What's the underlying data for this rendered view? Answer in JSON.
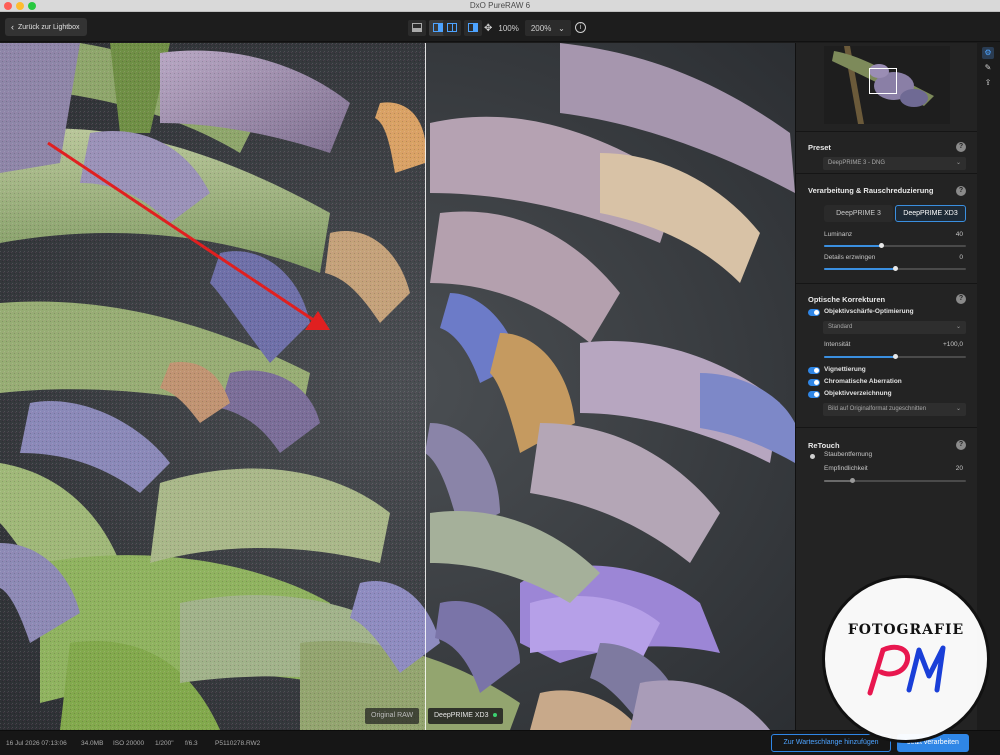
{
  "window": {
    "title": "DxO PureRAW 6"
  },
  "toolbar": {
    "back_label": "Zurück zur Lightbox",
    "zoom_fit": "100%",
    "zoom_level": "200%"
  },
  "viewer": {
    "label_original": "Original RAW",
    "label_processed": "DeepPRIME XD3"
  },
  "panel": {
    "preset": {
      "title": "Preset",
      "value": "DeepPRIME 3 - DNG"
    },
    "processing": {
      "title": "Verarbeitung & Rauschreduzierung",
      "option_a": "DeepPRIME 3",
      "option_b": "DeepPRIME XD3",
      "luminance_label": "Luminanz",
      "luminance_value": "40",
      "luminance_level": 0.4,
      "details_label": "Details erzwingen",
      "details_value": "0",
      "details_level": 0.5
    },
    "optics": {
      "title": "Optische Korrekturen",
      "sharpness_label": "Objektivschärfe-Optimierung",
      "sharpness_mode": "Standard",
      "intensity_label": "Intensität",
      "intensity_value": "+100,0",
      "intensity_level": 0.5,
      "vignetting_label": "Vignettierung",
      "chromatic_label": "Chromatische Aberration",
      "distortion_label": "Objektivverzeichnung",
      "distortion_mode": "Bild auf Originalformat zugeschnitten"
    },
    "retouch": {
      "title": "ReTouch",
      "dust_label": "Staubentfernung",
      "sensitivity_label": "Empfindlichkeit",
      "sensitivity_value": "20",
      "sensitivity_level": 0.2
    }
  },
  "status": {
    "date": "16 Jul 2026 07:13:06",
    "size": "34.0MB",
    "iso": "ISO 20000",
    "shutter": "1/200\"",
    "aperture": "f/6.3",
    "filename": "P5110278.RW2"
  },
  "actions": {
    "queue_label": "Zur Warteschlange hinzufügen",
    "process_label": "Jetzt verarbeiten"
  },
  "watermark": {
    "text": "FOTOGRAFIE",
    "initials": "PM"
  },
  "colors": {
    "accent": "#2f86e6",
    "annotation_arrow": "#e02020"
  }
}
